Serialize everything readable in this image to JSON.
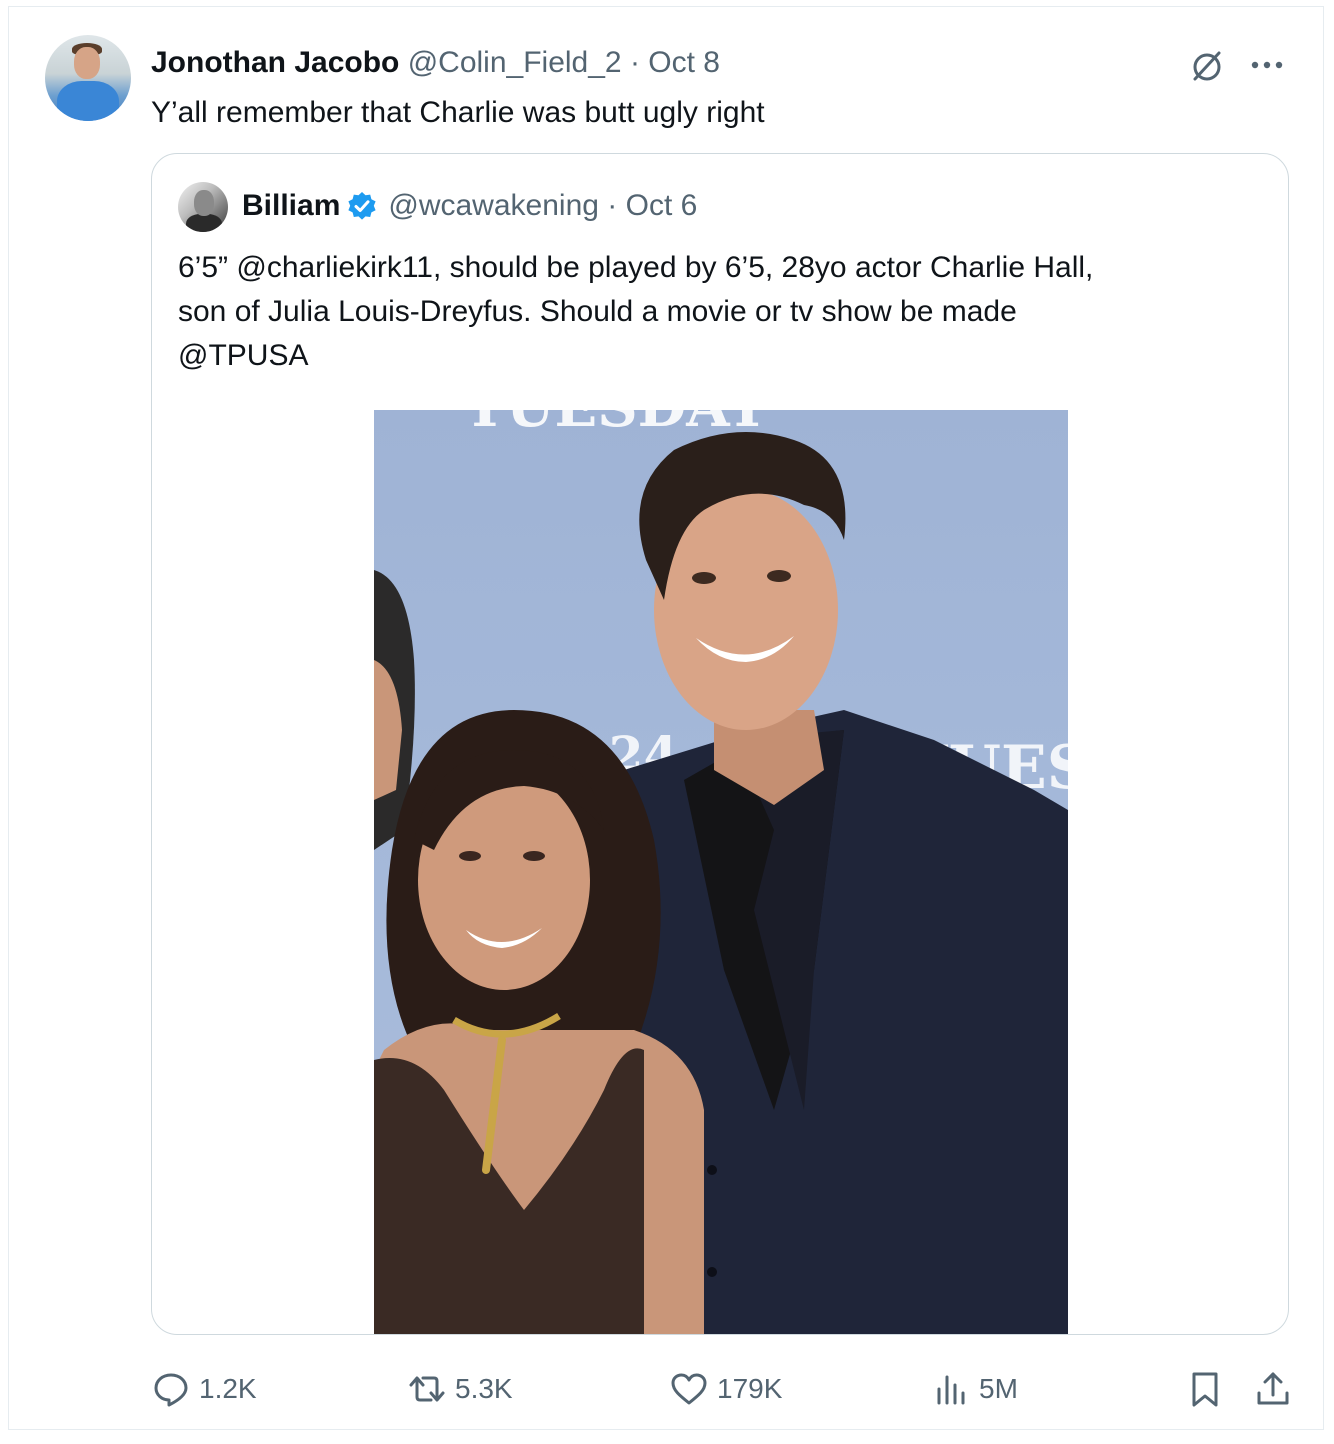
{
  "tweet": {
    "author_name": "Jonothan Jacobo",
    "author_handle": "@Colin_Field_2",
    "date": "Oct 8",
    "text": "Y’all remember that Charlie was butt ugly right",
    "icons": {
      "grok": "grok-slash-icon",
      "more": "more-dots-icon"
    }
  },
  "quoted": {
    "author_name": "Billiam",
    "author_handle": "@wcawakening",
    "date": "Oct 6",
    "verified": true,
    "text_lines": [
      "6’5” @charliekirk11, should be played by 6’5, 28yo actor Charlie Hall,",
      "son of Julia Louis-Dreyfus. Should a movie or tv show be made",
      "@TPUSA"
    ],
    "photo_backdrop_text": {
      "top": "TUESDAY",
      "middle": "A24",
      "right": "TUES"
    }
  },
  "actions": {
    "reply_count": "1.2K",
    "repost_count": "5.3K",
    "like_count": "179K",
    "views_count": "5M"
  },
  "colors": {
    "text_primary": "#0f1419",
    "text_secondary": "#536471",
    "border": "#cfd9de",
    "verified_blue": "#1d9bf0"
  }
}
